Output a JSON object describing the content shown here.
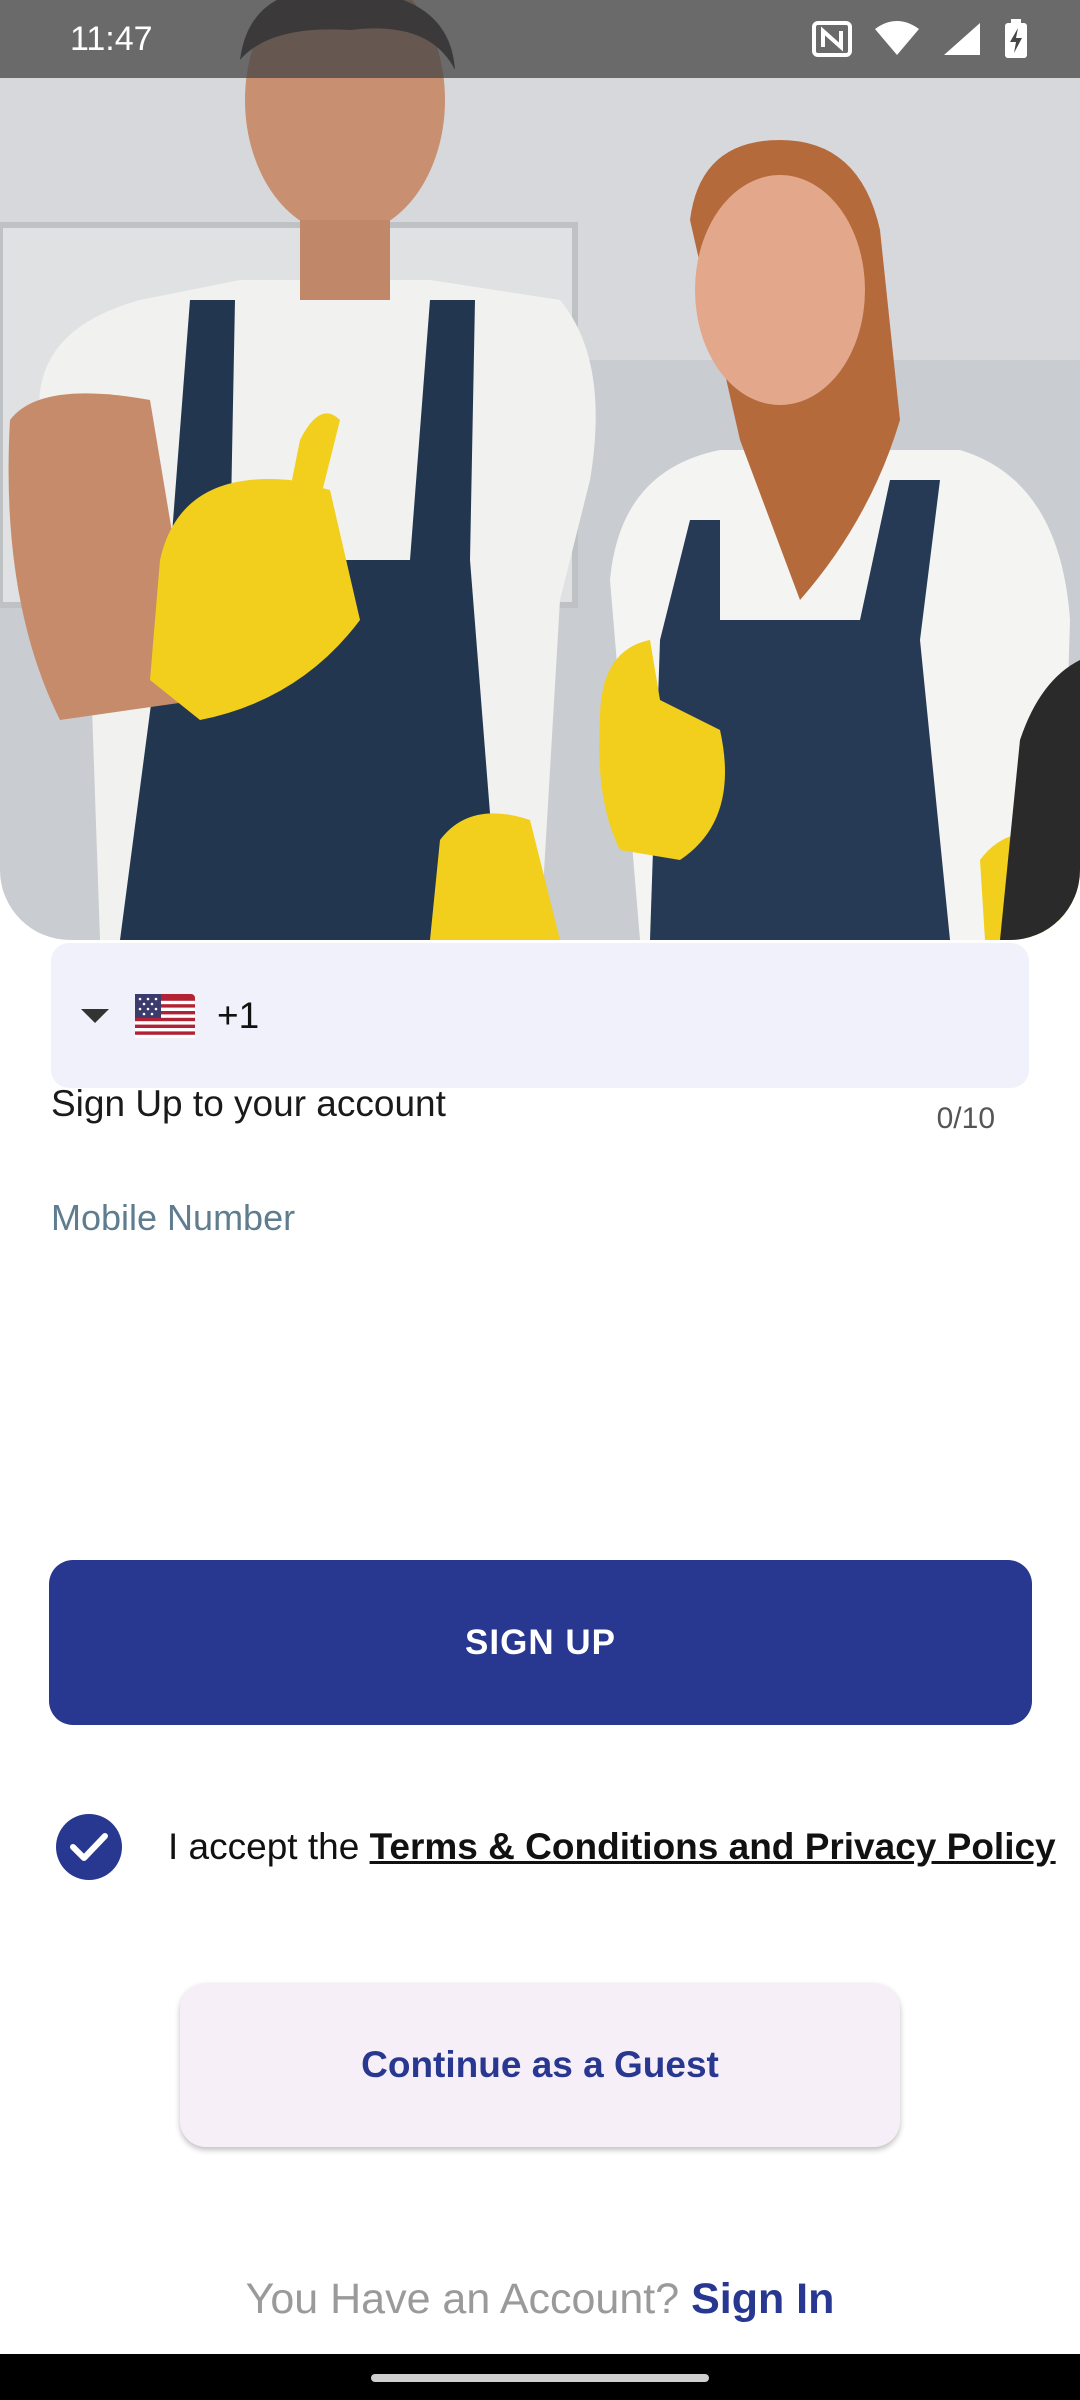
{
  "status_bar": {
    "time": "11:47",
    "icons": [
      "nfc-icon",
      "wifi-icon",
      "signal-icon",
      "battery-charging-icon"
    ]
  },
  "hero": {
    "icon": "hero-photo"
  },
  "phone_field": {
    "dropdown_icon": "caret-down-icon",
    "flag": "🇺🇸",
    "dial_code": "+1"
  },
  "form": {
    "heading": "Sign Up to your account",
    "counter": "0/10",
    "mobile_label": "Mobile Number"
  },
  "signup_button": {
    "label": "SIGN UP"
  },
  "terms": {
    "checked": true,
    "prefix": "I accept the ",
    "link": "Terms & Conditions and Privacy Policy"
  },
  "guest_button": {
    "label": "Continue as a Guest"
  },
  "signin": {
    "prompt": "You Have an Account? ",
    "link": "Sign In"
  },
  "colors": {
    "primary": "#283891",
    "field_bg": "#f1f1fb",
    "guest_bg": "#f7eff7",
    "label": "#5f7d8e"
  }
}
